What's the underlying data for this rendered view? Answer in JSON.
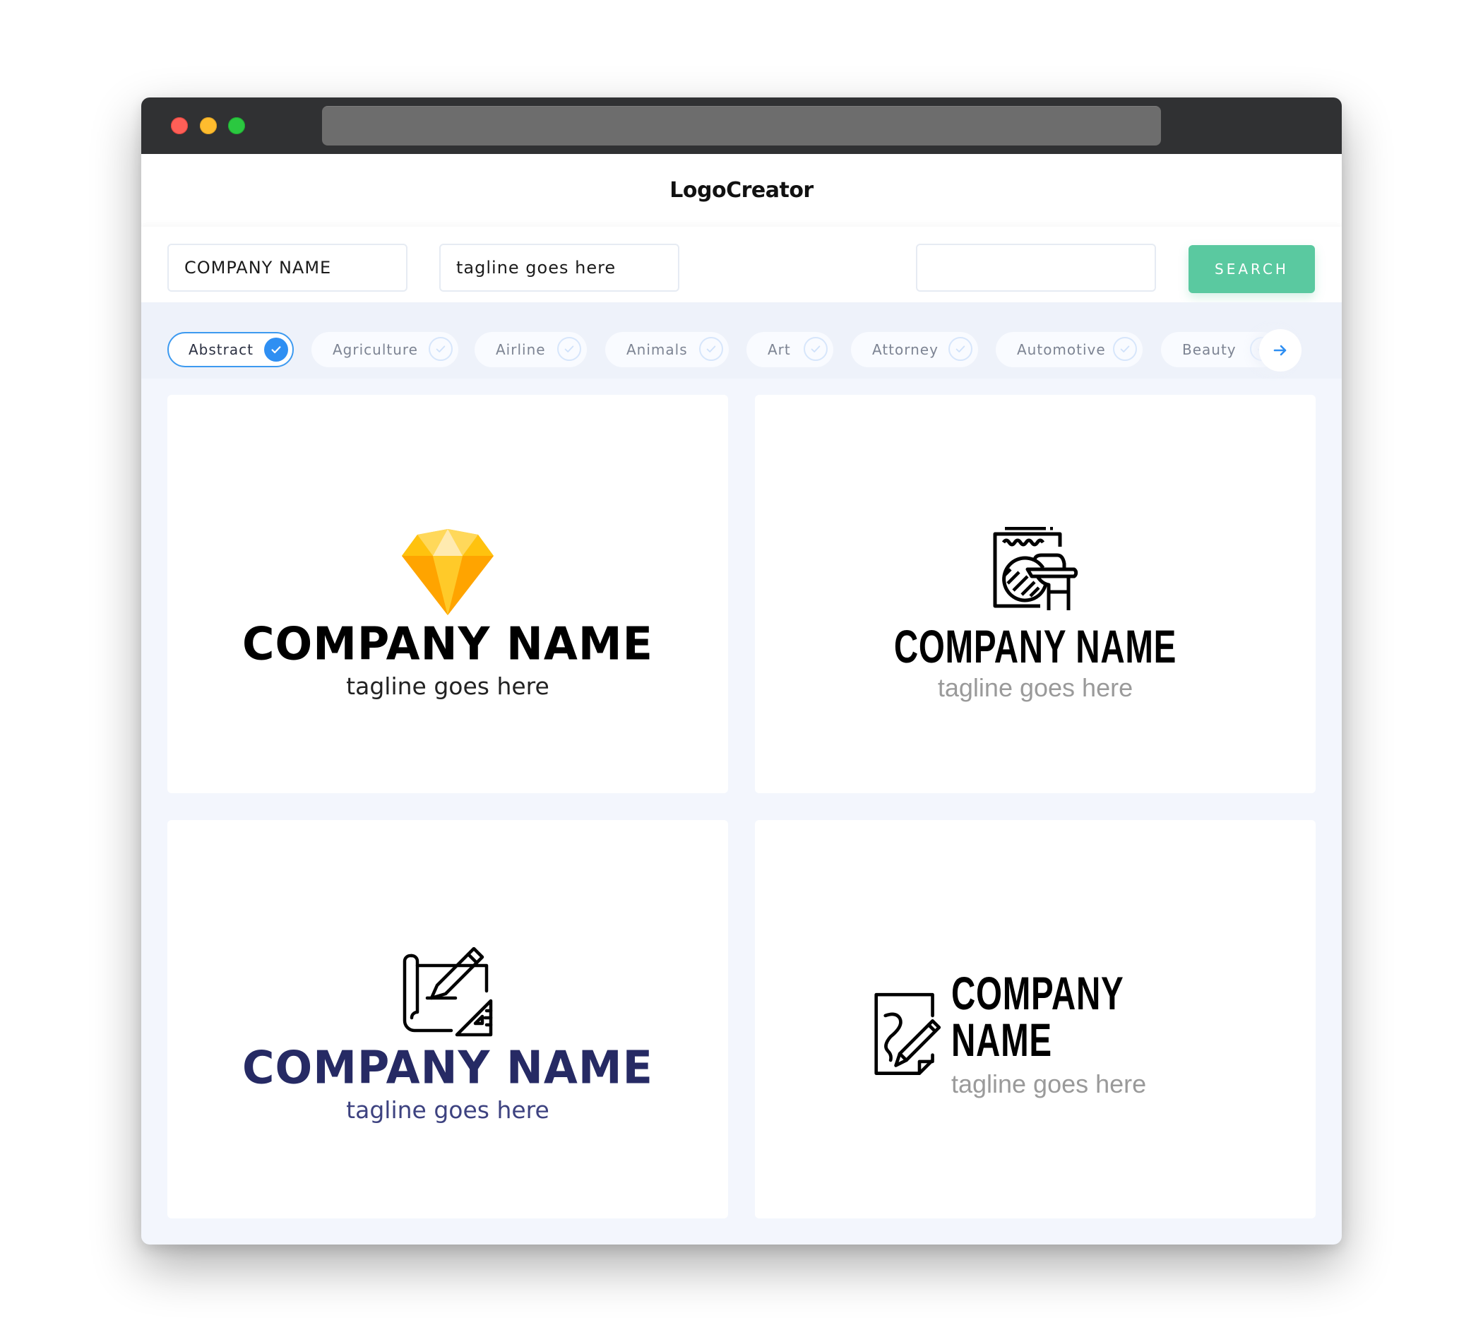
{
  "window": {
    "controls": [
      "close",
      "minimize",
      "maximize"
    ],
    "address_bar": ""
  },
  "header": {
    "title": "LogoCreator"
  },
  "search": {
    "company_name_value": "COMPANY NAME",
    "tagline_value": "tagline goes here",
    "keyword_value": "",
    "button_label": "SEARCH"
  },
  "categories": {
    "items": [
      {
        "label": "Abstract",
        "selected": true
      },
      {
        "label": "Agriculture",
        "selected": false
      },
      {
        "label": "Airline",
        "selected": false
      },
      {
        "label": "Animals",
        "selected": false
      },
      {
        "label": "Art",
        "selected": false
      },
      {
        "label": "Attorney",
        "selected": false
      },
      {
        "label": "Automotive",
        "selected": false
      },
      {
        "label": "Beauty",
        "selected": false
      }
    ],
    "next_icon": "arrow-right-icon"
  },
  "logos": [
    {
      "icon": "diamond-icon",
      "company_name": "COMPANY NAME",
      "tagline": "tagline goes here",
      "name_color": "#000000",
      "tagline_color": "#222222",
      "layout": "stacked"
    },
    {
      "icon": "artist-drawing-hand-icon",
      "company_name": "COMPANY NAME",
      "tagline": "tagline goes here",
      "name_color": "#000000",
      "tagline_color": "#9a9a9a",
      "layout": "stacked"
    },
    {
      "icon": "blueprint-pencil-ruler-icon",
      "company_name": "COMPANY NAME",
      "tagline": "tagline goes here",
      "name_color": "#262a64",
      "tagline_color": "#3d4280",
      "layout": "stacked"
    },
    {
      "icon": "document-pencil-signature-icon",
      "company_name": "COMPANY NAME",
      "tagline": "tagline goes here",
      "name_color": "#000000",
      "tagline_color": "#9a9a9a",
      "layout": "inline"
    }
  ],
  "colors": {
    "titlebar": "#303133",
    "accent_blue": "#2f8ff2",
    "search_button": "#5ac9a0",
    "page_bg": "#f3f6fd",
    "diamond_yellow": "#ffc728"
  }
}
